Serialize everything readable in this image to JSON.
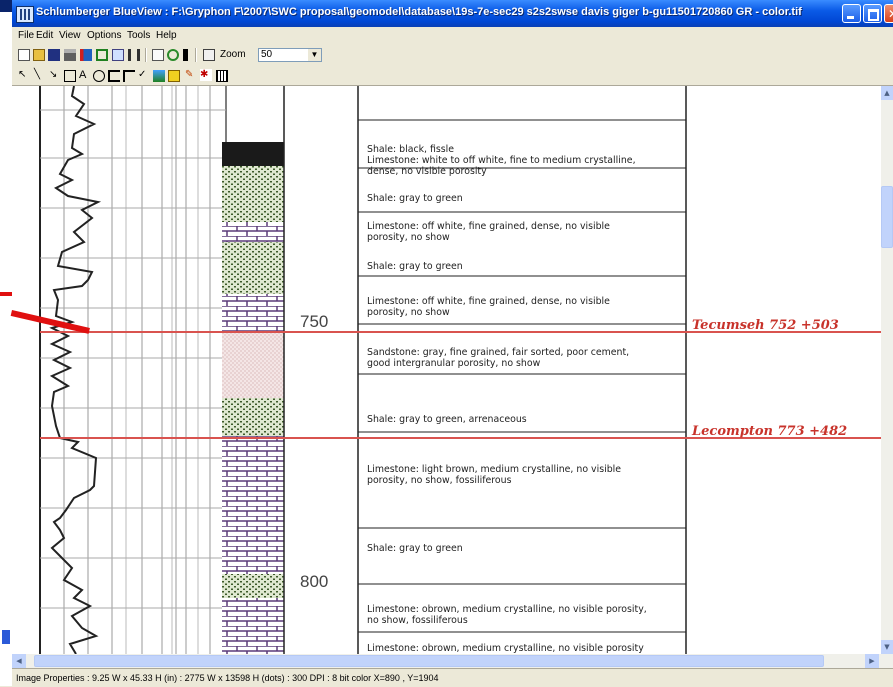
{
  "window": {
    "title": "Schlumberger BlueView : F:\\Gryphon F\\2007\\SWC proposal\\geomodel\\database\\19s-7e-sec29 s2s2swse davis giger b-gu11501720860 GR - color.tif",
    "app_icon": "blueview-app-icon",
    "controls": [
      "minimize-icon",
      "maximize-icon",
      "close-icon"
    ]
  },
  "menu": [
    "File",
    "Edit",
    "View",
    "Options",
    "Tools",
    "Help"
  ],
  "toolbar": {
    "zoom_label": "Zoom",
    "zoom_value": "50"
  },
  "log": {
    "depth_labels": [
      "750",
      "800"
    ],
    "descriptions": [
      [
        "Shale: black, fissle"
      ],
      [
        "Limestone: white to off white, fine to medium crystalline,",
        "dense, no visible porosity"
      ],
      [
        "Shale: gray to green"
      ],
      [
        "Limestone: off white, fine grained, dense, no visible",
        "porosity, no show"
      ],
      [
        "Shale: gray to green"
      ],
      [
        "Limestone: off white, fine grained, dense, no visible",
        "porosity, no show"
      ],
      [
        "Sandstone: gray, fine grained, fair sorted, poor cement,",
        "good intergranular porosity, no show"
      ],
      [
        "Shale: gray to green, arrenaceous"
      ],
      [
        "Limestone: light brown, medium crystalline, no visible",
        "porosity, no show, fossiliferous"
      ],
      [
        "Shale: gray to green"
      ],
      [
        "Limestone: obrown, medium crystalline, no visible porosity,",
        "no show, fossiliferous"
      ],
      [
        "Limestone: obrown, medium crystalline, no visible porosity"
      ]
    ],
    "formation_tops": [
      "Tecumseh 752 +503",
      "Lecompton 773 +482"
    ],
    "top_line_color": "#d9534f"
  },
  "status": {
    "text": "Image Properties :  9.25 W x 45.33 H (in) :  2775 W x 13598 H (dots)  : 300 DPI : 8 bit color   X=890 , Y=1904"
  }
}
